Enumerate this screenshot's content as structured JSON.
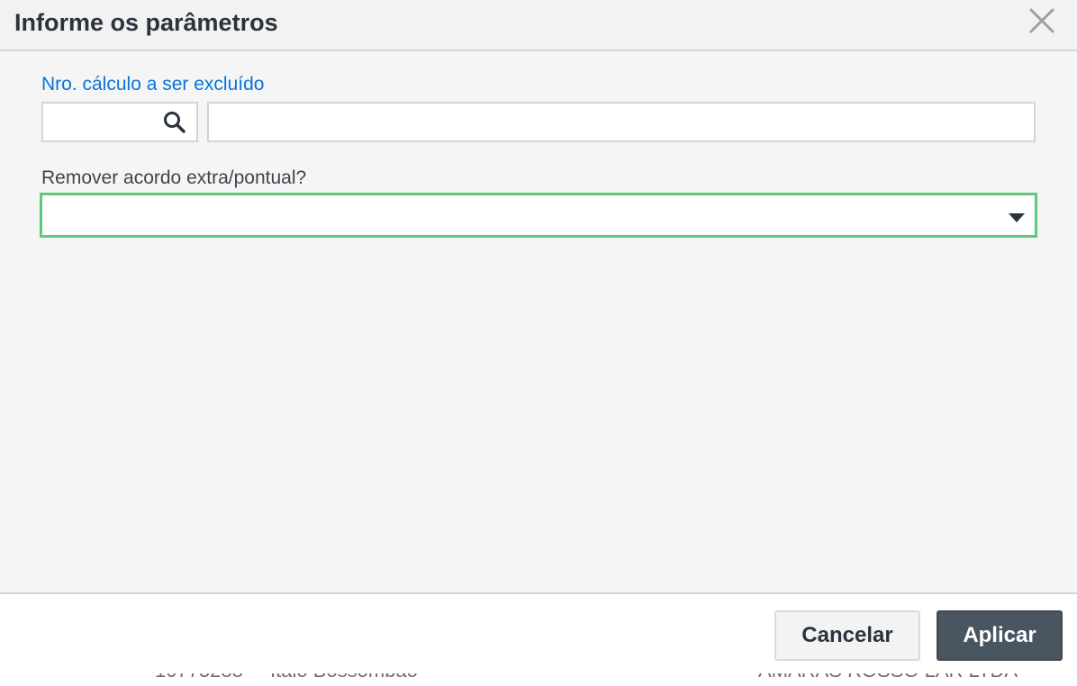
{
  "dialog": {
    "title": "Informe os parâmetros",
    "close_icon": "close-icon"
  },
  "fields": {
    "calc_number": {
      "label": "Nro. cálculo a ser excluído",
      "code_value": "",
      "description_value": "",
      "search_icon": "search-icon"
    },
    "remove_agreement": {
      "label": "Remover acordo extra/pontual?",
      "selected_value": "",
      "caret_icon": "caret-down-icon",
      "focus_color": "#5fc97a"
    }
  },
  "footer": {
    "cancel_label": "Cancelar",
    "apply_label": "Aplicar"
  },
  "colors": {
    "link_label": "#0a73db",
    "primary_button": "#4a5562",
    "title_text": "#2b333c"
  }
}
